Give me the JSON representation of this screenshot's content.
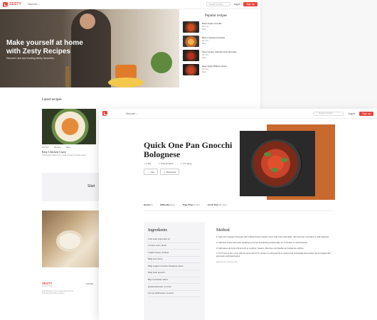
{
  "brand": {
    "name": "ZESTY",
    "tagline": "Recipes",
    "accent": "#e8453c"
  },
  "nav": {
    "menu": "Discover",
    "search_placeholder": "Search recipes",
    "login": "Log in",
    "signup": "Sign up"
  },
  "home": {
    "hero_title": "Make yourself at home with Zesty Recipes",
    "hero_subtitle": "Discover new and exciting family favourites",
    "popular_title": "Popular recipes",
    "popular": [
      {
        "title": "Basic Apple Crumble",
        "time": "20 mins",
        "level": "Easy"
      },
      {
        "title": "Bacon Carbonara Pasta",
        "time": "20 mins",
        "level": "Easy"
      },
      {
        "title": "Slow Cooker Chipotle Pork Shoulder",
        "time": "20 mins",
        "level": "Easy"
      },
      {
        "title": "Easy Apple Braised Roots",
        "time": "20 mins",
        "level": "Easy"
      }
    ],
    "latest_title": "Latest recipes",
    "latest_card": {
      "prep": "30 mins",
      "cook": "25 mins",
      "difficulty": "Easy",
      "title": "Easy Chicken Curry",
      "desc": "A flavourful chicken curry with a creamy tomato sauce."
    },
    "start_text": "Start",
    "footer": {
      "sub": "Zesty Recipes",
      "desc": "Zesty Recipes is the community for you to find new and exciting recipes.",
      "col": "Our links"
    }
  },
  "recipe": {
    "title": "Quick One Pan Gnocchi Bolognese",
    "stats": [
      "1 like",
      "0 Bookmarks",
      "4.5 rating"
    ],
    "like_label": "Like",
    "bookmark_label": "Bookmark",
    "facts": [
      {
        "label": "Serves",
        "value": "4"
      },
      {
        "label": "Difficulty",
        "value": "Easy"
      },
      {
        "label": "Prep Time",
        "value": "5 mins"
      },
      {
        "label": "Cook Time",
        "value": "30 mins"
      }
    ],
    "ingredients_title": "Ingredients",
    "ingredients": [
      "2 tbs extra virgin olive oil",
      "1 brown onion, diced",
      "2 garlic cloves, crushed",
      "500g beef mince",
      "500g Leggo's red wine bolognese sauce",
      "500g fresh gnocchi",
      "80g mozzarella, sliced",
      "grated parmesan, to serve",
      "1/2 cup basil leaves, to serve"
    ],
    "method_title": "Method",
    "method": [
      "1. Heat oil in a deep frying pan with a fitted lid over medium heat. Add onion and garlic, then cook for 4 minutes or until softened.",
      "2. Add beef mince and cook, breaking up lumps and stirring occasionally, for 5 minutes or until browned.",
      "3. Add sauce and gnocchi and stir to combine. Season. Remove mozzarella into bolognese surface.",
      "4. Turn heat to low, cover with lid, and cook for 5 minutes or until gnocchi is cooked and mozzarella has melted. Serve topped with parmesan and basil leaves."
    ],
    "method_note": "Reviews are coming soon"
  }
}
